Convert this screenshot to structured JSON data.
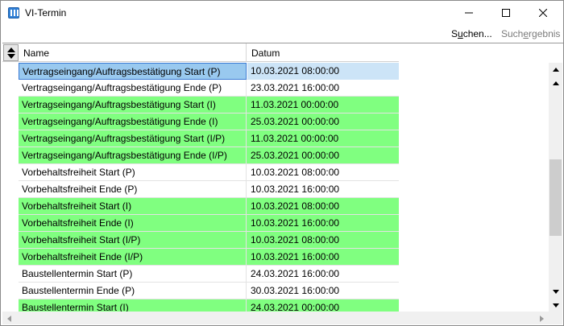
{
  "window": {
    "title": "VI-Termin"
  },
  "menu": {
    "search_pre": "S",
    "search_u": "u",
    "search_post": "chen...",
    "result_pre": "Such",
    "result_u": "e",
    "result_post": "rgebnis"
  },
  "table": {
    "columns": {
      "name": "Name",
      "date": "Datum"
    },
    "rows": [
      {
        "name": "Vertragseingang/Auftragsbestätigung Start (P)",
        "date": "10.03.2021 08:00:00",
        "style": "selected"
      },
      {
        "name": "Vertragseingang/Auftragsbestätigung Ende (P)",
        "date": "23.03.2021 16:00:00",
        "style": "white"
      },
      {
        "name": "Vertragseingang/Auftragsbestätigung Start (I)",
        "date": "11.03.2021 00:00:00",
        "style": "green"
      },
      {
        "name": "Vertragseingang/Auftragsbestätigung Ende (I)",
        "date": "25.03.2021 00:00:00",
        "style": "green"
      },
      {
        "name": "Vertragseingang/Auftragsbestätigung Start (I/P)",
        "date": "11.03.2021 00:00:00",
        "style": "green"
      },
      {
        "name": "Vertragseingang/Auftragsbestätigung Ende (I/P)",
        "date": "25.03.2021 00:00:00",
        "style": "green"
      },
      {
        "name": "Vorbehaltsfreiheit Start (P)",
        "date": "10.03.2021 08:00:00",
        "style": "white"
      },
      {
        "name": "Vorbehaltsfreiheit Ende (P)",
        "date": "10.03.2021 16:00:00",
        "style": "white"
      },
      {
        "name": "Vorbehaltsfreiheit Start (I)",
        "date": "10.03.2021 08:00:00",
        "style": "green"
      },
      {
        "name": "Vorbehaltsfreiheit Ende (I)",
        "date": "10.03.2021 16:00:00",
        "style": "green"
      },
      {
        "name": "Vorbehaltsfreiheit Start (I/P)",
        "date": "10.03.2021 08:00:00",
        "style": "green"
      },
      {
        "name": "Vorbehaltsfreiheit Ende (I/P)",
        "date": "10.03.2021 16:00:00",
        "style": "green"
      },
      {
        "name": "Baustellentermin Start (P)",
        "date": "24.03.2021 16:00:00",
        "style": "white"
      },
      {
        "name": "Baustellentermin Ende (P)",
        "date": "30.03.2021 16:00:00",
        "style": "white"
      },
      {
        "name": "Baustellentermin Start (I)",
        "date": "24.03.2021 00:00:00",
        "style": "green"
      }
    ]
  },
  "colors": {
    "green_row": "#80ff80",
    "selected_name": "#99c9ef",
    "selected_date": "#cce4f7"
  },
  "icons": [
    "app-icon",
    "minimize-icon",
    "maximize-icon",
    "close-icon",
    "sort-icon",
    "scroll-up-icon",
    "scroll-down-icon",
    "scroll-left-icon",
    "scroll-right-icon"
  ]
}
